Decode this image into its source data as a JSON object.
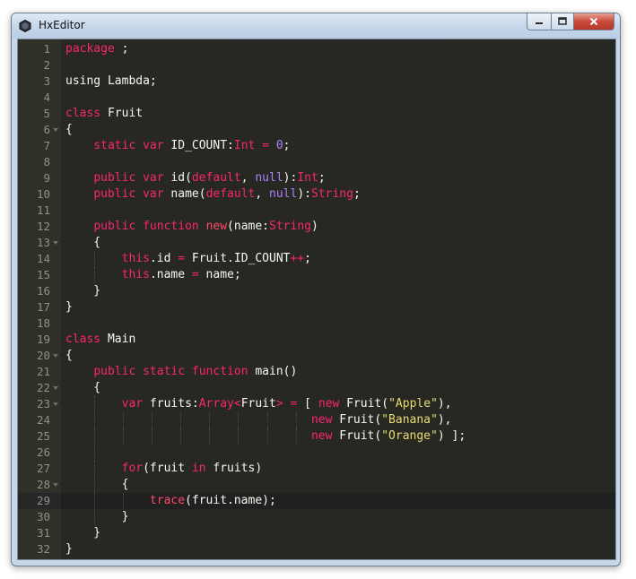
{
  "window": {
    "title": "HxEditor",
    "icon": "hexagon-icon",
    "controls": {
      "minimize": "minimize-icon",
      "maximize": "maximize-icon",
      "close": "close-icon"
    }
  },
  "theme": {
    "keyword": "#f92672",
    "number": "#ae81ff",
    "string": "#e6db74",
    "text": "#f8f8f2",
    "background": "#272822",
    "line_numbers": "#8f908a"
  },
  "editor": {
    "active_line": 29,
    "lines": [
      {
        "n": "1",
        "fold": false,
        "guides": 0,
        "tokens": [
          [
            "kw",
            "package"
          ],
          [
            "pl",
            " ;"
          ]
        ]
      },
      {
        "n": "2",
        "fold": false,
        "guides": 0,
        "tokens": []
      },
      {
        "n": "3",
        "fold": false,
        "guides": 0,
        "tokens": [
          [
            "pl",
            "using Lambda;"
          ]
        ]
      },
      {
        "n": "4",
        "fold": false,
        "guides": 0,
        "tokens": []
      },
      {
        "n": "5",
        "fold": false,
        "guides": 0,
        "tokens": [
          [
            "kw",
            "class"
          ],
          [
            "pl",
            " Fruit"
          ]
        ]
      },
      {
        "n": "6",
        "fold": true,
        "guides": 0,
        "tokens": [
          [
            "pl",
            "{"
          ]
        ]
      },
      {
        "n": "7",
        "fold": false,
        "guides": 0,
        "tokens": [
          [
            "pl",
            "    "
          ],
          [
            "kw",
            "static"
          ],
          [
            "pl",
            " "
          ],
          [
            "kw",
            "var"
          ],
          [
            "pl",
            " ID_COUNT:"
          ],
          [
            "ty",
            "Int"
          ],
          [
            "pl",
            " "
          ],
          [
            "op",
            "="
          ],
          [
            "pl",
            " "
          ],
          [
            "num",
            "0"
          ],
          [
            "pl",
            ";"
          ]
        ]
      },
      {
        "n": "8",
        "fold": false,
        "guides": 0,
        "tokens": []
      },
      {
        "n": "9",
        "fold": false,
        "guides": 0,
        "tokens": [
          [
            "pl",
            "    "
          ],
          [
            "kw",
            "public"
          ],
          [
            "pl",
            " "
          ],
          [
            "kw",
            "var"
          ],
          [
            "pl",
            " id("
          ],
          [
            "kw",
            "default"
          ],
          [
            "pl",
            ", "
          ],
          [
            "num",
            "null"
          ],
          [
            "pl",
            "):"
          ],
          [
            "ty",
            "Int"
          ],
          [
            "pl",
            ";"
          ]
        ]
      },
      {
        "n": "10",
        "fold": false,
        "guides": 0,
        "tokens": [
          [
            "pl",
            "    "
          ],
          [
            "kw",
            "public"
          ],
          [
            "pl",
            " "
          ],
          [
            "kw",
            "var"
          ],
          [
            "pl",
            " name("
          ],
          [
            "kw",
            "default"
          ],
          [
            "pl",
            ", "
          ],
          [
            "num",
            "null"
          ],
          [
            "pl",
            "):"
          ],
          [
            "ty",
            "String"
          ],
          [
            "pl",
            ";"
          ]
        ]
      },
      {
        "n": "11",
        "fold": false,
        "guides": 0,
        "tokens": []
      },
      {
        "n": "12",
        "fold": false,
        "guides": 0,
        "tokens": [
          [
            "pl",
            "    "
          ],
          [
            "kw",
            "public"
          ],
          [
            "pl",
            " "
          ],
          [
            "kw",
            "function"
          ],
          [
            "pl",
            " "
          ],
          [
            "fn",
            "new"
          ],
          [
            "pl",
            "(name:"
          ],
          [
            "ty",
            "String"
          ],
          [
            "pl",
            ")"
          ]
        ]
      },
      {
        "n": "13",
        "fold": true,
        "guides": 0,
        "tokens": [
          [
            "pl",
            "    {"
          ]
        ]
      },
      {
        "n": "14",
        "fold": false,
        "guides": 1,
        "tokens": [
          [
            "pl",
            "        "
          ],
          [
            "kw",
            "this"
          ],
          [
            "pl",
            ".id "
          ],
          [
            "op",
            "="
          ],
          [
            "pl",
            " Fruit.ID_COUNT"
          ],
          [
            "op",
            "++"
          ],
          [
            "pl",
            ";"
          ]
        ]
      },
      {
        "n": "15",
        "fold": false,
        "guides": 1,
        "tokens": [
          [
            "pl",
            "        "
          ],
          [
            "kw",
            "this"
          ],
          [
            "pl",
            ".name "
          ],
          [
            "op",
            "="
          ],
          [
            "pl",
            " name;"
          ]
        ]
      },
      {
        "n": "16",
        "fold": false,
        "guides": 0,
        "tokens": [
          [
            "pl",
            "    }"
          ]
        ]
      },
      {
        "n": "17",
        "fold": false,
        "guides": 0,
        "tokens": [
          [
            "pl",
            "}"
          ]
        ]
      },
      {
        "n": "18",
        "fold": false,
        "guides": 0,
        "tokens": []
      },
      {
        "n": "19",
        "fold": false,
        "guides": 0,
        "tokens": [
          [
            "kw",
            "class"
          ],
          [
            "pl",
            " Main"
          ]
        ]
      },
      {
        "n": "20",
        "fold": true,
        "guides": 0,
        "tokens": [
          [
            "pl",
            "{"
          ]
        ]
      },
      {
        "n": "21",
        "fold": false,
        "guides": 0,
        "tokens": [
          [
            "pl",
            "    "
          ],
          [
            "kw",
            "public"
          ],
          [
            "pl",
            " "
          ],
          [
            "kw",
            "static"
          ],
          [
            "pl",
            " "
          ],
          [
            "kw",
            "function"
          ],
          [
            "pl",
            " main()"
          ]
        ]
      },
      {
        "n": "22",
        "fold": true,
        "guides": 0,
        "tokens": [
          [
            "pl",
            "    {"
          ]
        ]
      },
      {
        "n": "23",
        "fold": true,
        "guides": 1,
        "tokens": [
          [
            "pl",
            "        "
          ],
          [
            "kw",
            "var"
          ],
          [
            "pl",
            " fruits:"
          ],
          [
            "ty",
            "Array"
          ],
          [
            "op",
            "<"
          ],
          [
            "pl",
            "Fruit"
          ],
          [
            "op",
            ">"
          ],
          [
            "pl",
            " "
          ],
          [
            "op",
            "="
          ],
          [
            "pl",
            " [ "
          ],
          [
            "kw",
            "new"
          ],
          [
            "pl",
            " Fruit("
          ],
          [
            "str",
            "\"Apple\""
          ],
          [
            "pl",
            "),"
          ]
        ]
      },
      {
        "n": "24",
        "fold": false,
        "guides": 8,
        "tokens": [
          [
            "pl",
            "                                   "
          ],
          [
            "kw",
            "new"
          ],
          [
            "pl",
            " Fruit("
          ],
          [
            "str",
            "\"Banana\""
          ],
          [
            "pl",
            "),"
          ]
        ]
      },
      {
        "n": "25",
        "fold": false,
        "guides": 8,
        "tokens": [
          [
            "pl",
            "                                   "
          ],
          [
            "kw",
            "new"
          ],
          [
            "pl",
            " Fruit("
          ],
          [
            "str",
            "\"Orange\""
          ],
          [
            "pl",
            ") ];"
          ]
        ]
      },
      {
        "n": "26",
        "fold": false,
        "guides": 1,
        "tokens": []
      },
      {
        "n": "27",
        "fold": false,
        "guides": 1,
        "tokens": [
          [
            "pl",
            "        "
          ],
          [
            "kw",
            "for"
          ],
          [
            "pl",
            "(fruit "
          ],
          [
            "kw",
            "in"
          ],
          [
            "pl",
            " fruits)"
          ]
        ]
      },
      {
        "n": "28",
        "fold": true,
        "guides": 1,
        "tokens": [
          [
            "pl",
            "        {"
          ]
        ]
      },
      {
        "n": "29",
        "fold": false,
        "guides": 2,
        "tokens": [
          [
            "pl",
            "            "
          ],
          [
            "fn",
            "trace"
          ],
          [
            "pl",
            "(fruit.name);"
          ]
        ]
      },
      {
        "n": "30",
        "fold": false,
        "guides": 1,
        "tokens": [
          [
            "pl",
            "        }"
          ]
        ]
      },
      {
        "n": "31",
        "fold": false,
        "guides": 0,
        "tokens": [
          [
            "pl",
            "    }"
          ]
        ]
      },
      {
        "n": "32",
        "fold": false,
        "guides": 0,
        "tokens": [
          [
            "pl",
            "}"
          ]
        ]
      }
    ]
  }
}
